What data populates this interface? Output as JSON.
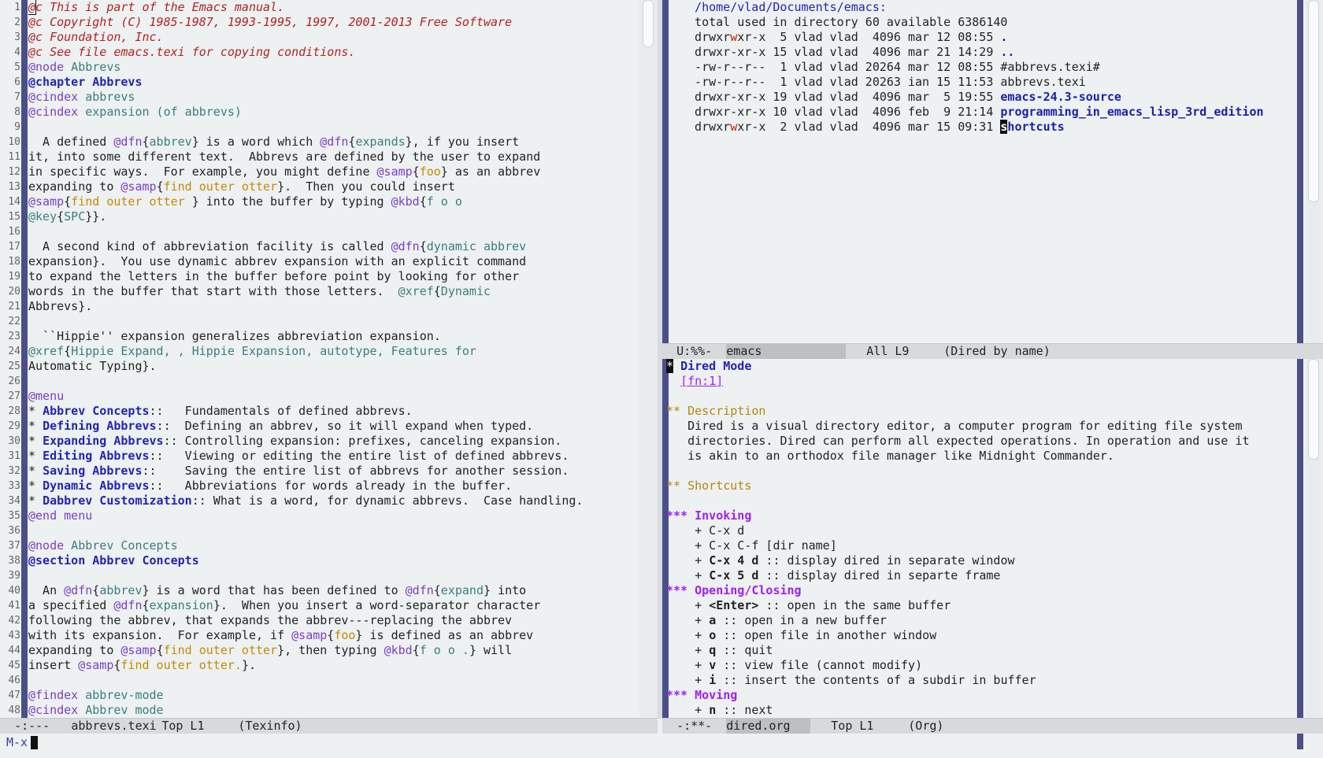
{
  "left_pane": {
    "line_numbers": [
      "1",
      "2",
      "3",
      "4",
      "5",
      "6",
      "7",
      "8",
      "9",
      "10",
      "11",
      "12",
      "13",
      "14",
      "15",
      "16",
      "17",
      "18",
      "19",
      "20",
      "21",
      "22",
      "23",
      "24",
      "25",
      "26",
      "27",
      "28",
      "29",
      "30",
      "31",
      "32",
      "33",
      "34",
      "35",
      "36",
      "37",
      "38",
      "39",
      "40",
      "41",
      "42",
      "43",
      "44",
      "45",
      "46",
      "47",
      "48"
    ],
    "lines": [
      "@c This is part of the Emacs manual.",
      "@c Copyright (C) 1985-1987, 1993-1995, 1997, 2001-2013 Free Software",
      "@c Foundation, Inc.",
      "@c See file emacs.texi for copying conditions.",
      "@node Abbrevs",
      "@chapter Abbrevs",
      "@cindex abbrevs",
      "@cindex expansion (of abbrevs)",
      "",
      "  A defined @dfn{abbrev} is a word which @dfn{expands}, if you insert",
      "it, into some different text.  Abbrevs are defined by the user to expand",
      "in specific ways.  For example, you might define @samp{foo} as an abbrev",
      "expanding to @samp{find outer otter}.  Then you could insert",
      "@samp{find outer otter } into the buffer by typing @kbd{f o o",
      "@key{SPC}}.",
      "",
      "  A second kind of abbreviation facility is called @dfn{dynamic abbrev",
      "expansion}.  You use dynamic abbrev expansion with an explicit command",
      "to expand the letters in the buffer before point by looking for other",
      "words in the buffer that start with those letters.  @xref{Dynamic",
      "Abbrevs}.",
      "",
      "  ``Hippie'' expansion generalizes abbreviation expansion.",
      "@xref{Hippie Expand, , Hippie Expansion, autotype, Features for",
      "Automatic Typing}.",
      "",
      "@menu",
      "* Abbrev Concepts::   Fundamentals of defined abbrevs.",
      "* Defining Abbrevs::  Defining an abbrev, so it will expand when typed.",
      "* Expanding Abbrevs:: Controlling expansion: prefixes, canceling expansion.",
      "* Editing Abbrevs::   Viewing or editing the entire list of defined abbrevs.",
      "* Saving Abbrevs::    Saving the entire list of abbrevs for another session.",
      "* Dynamic Abbrevs::   Abbreviations for words already in the buffer.",
      "* Dabbrev Customization:: What is a word, for dynamic abbrevs.  Case handling.",
      "@end menu",
      "",
      "@node Abbrev Concepts",
      "@section Abbrev Concepts",
      "",
      "  An @dfn{abbrev} is a word that has been defined to @dfn{expand} into",
      "a specified @dfn{expansion}.  When you insert a word-separator character",
      "following the abbrev, that expands the abbrev---replacing the abbrev",
      "with its expansion.  For example, if @samp{foo} is defined as an abbrev",
      "expanding to @samp{find outer otter}, then typing @kbd{f o o .} will",
      "insert @samp{find outer otter.}.",
      "",
      "@findex abbrev-mode",
      "@cindex Abbrev mode"
    ],
    "modeline": {
      "status": "-:---",
      "buffer": "abbrevs.texi",
      "position": "Top L1",
      "mode": "(Texinfo)"
    }
  },
  "right_top": {
    "lines": [
      "  /home/vlad/Documents/emacs:",
      "  total used in directory 60 available 6386140",
      "  drwxrwxr-x  5 vlad vlad  4096 mar 12 08:55 .",
      "  drwxr-xr-x 15 vlad vlad  4096 mar 21 14:29 ..",
      "  -rw-r--r--  1 vlad vlad 20264 mar 12 08:55 #abbrevs.texi#",
      "  -rw-r--r--  1 vlad vlad 20263 ian 15 11:53 abbrevs.texi",
      "  drwxr-xr-x 19 vlad vlad  4096 mar  5 19:55 emacs-24.3-source",
      "  drwxr-xr-x 10 vlad vlad  4096 feb  9 21:14 programming_in_emacs_lisp_3rd_edition",
      "  drwxrwxr-x  2 vlad vlad  4096 mar 15 09:31 shortcuts"
    ],
    "modeline": {
      "status": "U:%%-",
      "buffer": "emacs",
      "position": "All L9",
      "mode": "(Dired by name)"
    }
  },
  "right_bottom": {
    "lines": [
      "* Dired Mode",
      "  [fn:1]",
      "",
      "** Description",
      "   Dired is a visual directory editor, a computer program for editing file system",
      "   directories. Dired can perform all expected operations. In operation and use it",
      "   is akin to an orthodox file manager like Midnight Commander.",
      "",
      "** Shortcuts",
      "",
      "*** Invoking",
      "    + C-x d",
      "    + C-x C-f [dir name]",
      "    + C-x 4 d :: display dired in separate window",
      "    + C-x 5 d :: display dired in separte frame",
      "*** Opening/Closing",
      "    + <Enter> :: open in the same buffer",
      "    + a :: open in a new buffer",
      "    + o :: open file in another window",
      "    + q :: quit",
      "    + v :: view file (cannot modify)",
      "    + i :: insert the contents of a subdir in buffer",
      "*** Moving",
      "    + n :: next"
    ],
    "modeline": {
      "status": "-:**-",
      "buffer": "dired.org",
      "position": "Top L1",
      "mode": "(Org)"
    }
  },
  "minibuffer": {
    "prompt": "M-x"
  }
}
